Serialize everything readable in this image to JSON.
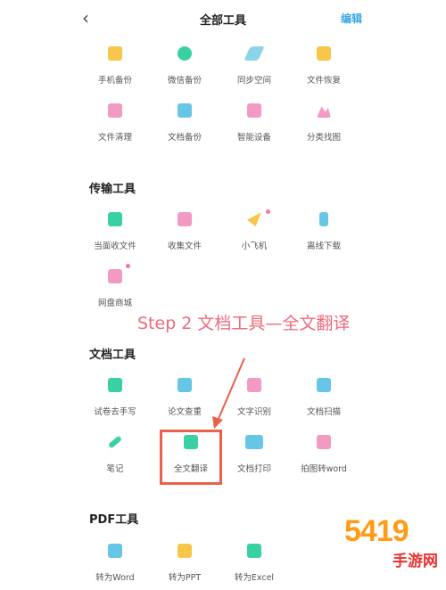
{
  "header": {
    "back_icon": "chevron-left-icon",
    "title": "全部工具",
    "edit_label": "编辑"
  },
  "top_tools": [
    {
      "label": "手机备份",
      "color": "#f8c64a"
    },
    {
      "label": "微信备份",
      "color": "#39d1a3"
    },
    {
      "label": "同步空间",
      "color": "#8ad6e8"
    },
    {
      "label": "文件恢复",
      "color": "#f8c64a"
    },
    {
      "label": "文件清理",
      "color": "#f29ac2"
    },
    {
      "label": "文档备份",
      "color": "#67c6e6"
    },
    {
      "label": "智能设备",
      "color": "#f29ac2"
    },
    {
      "label": "分类找图",
      "color": "#f29ac2"
    }
  ],
  "transfer": {
    "title": "传输工具",
    "tools": [
      {
        "label": "当面收文件",
        "color": "#39d1a3"
      },
      {
        "label": "收集文件",
        "color": "#f29ac2"
      },
      {
        "label": "小飞机",
        "color": "#f8c64a"
      },
      {
        "label": "离线下载",
        "color": "#67c6e6"
      },
      {
        "label": "网盘商城",
        "color": "#f29ac2"
      }
    ]
  },
  "annotation": {
    "text": "Step 2 文档工具—全文翻译"
  },
  "docs": {
    "title": "文档工具",
    "tools": [
      {
        "label": "试卷去手写",
        "color": "#39d1a3"
      },
      {
        "label": "论文查重",
        "color": "#67c6e6"
      },
      {
        "label": "文字识别",
        "color": "#f29ac2"
      },
      {
        "label": "文档扫描",
        "color": "#67c6e6"
      },
      {
        "label": "笔记",
        "color": "#39d1a3"
      },
      {
        "label": "全文翻译",
        "color": "#39d1a3"
      },
      {
        "label": "文档打印",
        "color": "#67c6e6"
      },
      {
        "label": "拍图转word",
        "color": "#f29ac2"
      }
    ]
  },
  "pdf": {
    "title": "PDF工具",
    "tools": [
      {
        "label": "转为Word",
        "color": "#67c6e6"
      },
      {
        "label": "转为PPT",
        "color": "#f8c64a"
      },
      {
        "label": "转为Excel",
        "color": "#39d1a3"
      }
    ]
  },
  "watermark": {
    "big": "5419",
    "small": "手游网"
  }
}
